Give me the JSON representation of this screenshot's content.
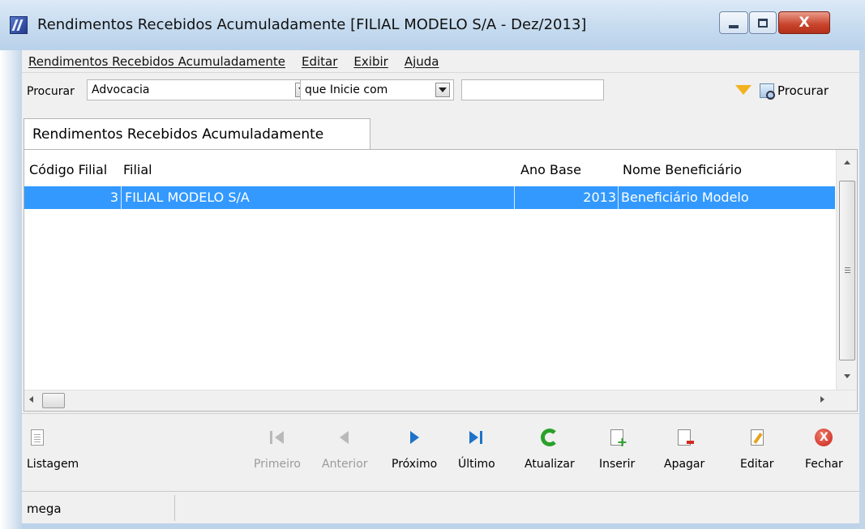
{
  "window": {
    "title": "Rendimentos Recebidos Acumuladamente [FILIAL MODELO S/A - Dez/2013]",
    "close_glyph": "X"
  },
  "menu": {
    "items": [
      "Rendimentos Recebidos Acumuladamente",
      "Editar",
      "Exibir",
      "Ajuda"
    ]
  },
  "search": {
    "label": "Procurar",
    "field_value": "Advocacia",
    "mode_value": "que Inicie com",
    "text_value": "",
    "button_label": "Procurar"
  },
  "tab": {
    "label": "Rendimentos Recebidos Acumuladamente"
  },
  "grid": {
    "columns": [
      "Código Filial",
      "Filial",
      "Ano Base",
      "Nome Beneficiário"
    ],
    "rows": [
      {
        "codigo": "3",
        "filial": "FILIAL MODELO S/A",
        "ano": "2013",
        "nome": "Beneficiário Modelo",
        "selected": true
      }
    ]
  },
  "toolbar": {
    "listagem": "Listagem",
    "primeiro": "Primeiro",
    "anterior": "Anterior",
    "proximo": "Próximo",
    "ultimo": "Último",
    "atualizar": "Atualizar",
    "inserir": "Inserir",
    "apagar": "Apagar",
    "editar": "Editar",
    "fechar": "Fechar"
  },
  "status": {
    "text": "mega"
  },
  "colors": {
    "selection": "#3399ff",
    "close_button": "#c8432b"
  }
}
